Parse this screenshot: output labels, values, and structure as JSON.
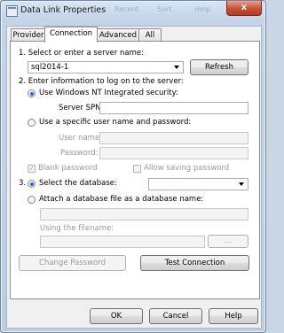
{
  "window": {
    "title": "Data Link Properties",
    "close_glyph": "x"
  },
  "background_window": {
    "items": [
      "Recent",
      "Sort",
      "Help"
    ]
  },
  "tabs": [
    {
      "label": "Provider",
      "active": false
    },
    {
      "label": "Connection",
      "active": true
    },
    {
      "label": "Advanced",
      "active": false
    },
    {
      "label": "All",
      "active": false
    }
  ],
  "step1": {
    "label": "1. Select or enter a server name:",
    "server_value": "sql2014-1",
    "refresh_label": "Refresh"
  },
  "step2": {
    "label": "2. Enter information to log on to the server:",
    "option_windows_nt": "Use Windows NT Integrated security:",
    "server_spn_label": "Server SPN:",
    "server_spn_value": "",
    "option_specific_user": "Use a specific user name and password:",
    "user_name_label": "User name:",
    "password_label": "Password:",
    "blank_password_label": "Blank password",
    "allow_saving_label": "Allow saving password"
  },
  "step3": {
    "label_prefix": "3.",
    "option_select_db": "Select the database:",
    "database_value": "",
    "option_attach_db": "Attach a database file as a database name:",
    "using_filename_label": "Using the filename:",
    "browse_label": "..."
  },
  "buttons": {
    "change_password": "Change Password",
    "test_connection": "Test Connection",
    "ok": "OK",
    "cancel": "Cancel",
    "help": "Help"
  },
  "colors": {
    "accent": "#1f6ad4",
    "close": "#c94f36"
  }
}
